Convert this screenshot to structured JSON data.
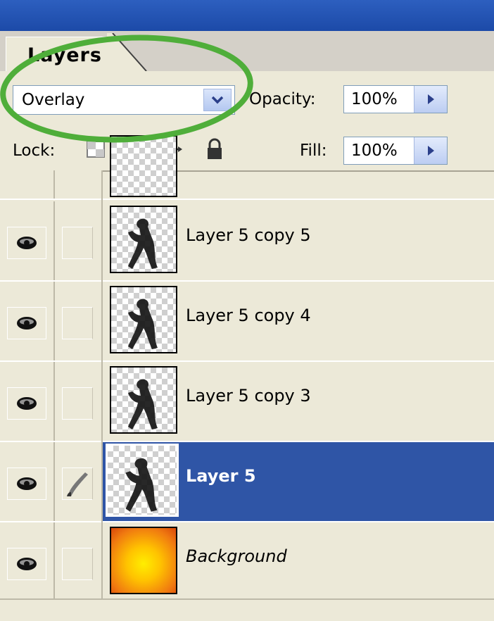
{
  "panel": {
    "tab_label": "Layers",
    "blend_mode": "Overlay",
    "opacity_label": "Opacity:",
    "opacity_value": "100%",
    "lock_label": "Lock:",
    "fill_label": "Fill:",
    "fill_value": "100%",
    "lock_icons": [
      "lock-transparent-pixels-icon",
      "lock-image-pixels-icon",
      "lock-position-icon",
      "lock-all-icon"
    ]
  },
  "layers": [
    {
      "name": "",
      "visible": true,
      "thumb": "checker-partial"
    },
    {
      "name": "Layer 5 copy 5",
      "visible": true,
      "thumb": "figure"
    },
    {
      "name": "Layer 5 copy 4",
      "visible": true,
      "thumb": "figure"
    },
    {
      "name": "Layer 5 copy 3",
      "visible": true,
      "thumb": "figure"
    },
    {
      "name": "Layer 5",
      "visible": true,
      "selected": true,
      "brush": true,
      "thumb": "figure"
    },
    {
      "name": "Background",
      "visible": true,
      "italic": true,
      "thumb": "gradient"
    }
  ],
  "colors": {
    "selection": "#2f55a6",
    "highlight_ellipse": "#4fae3a",
    "panel_bg": "#ece9d8"
  }
}
